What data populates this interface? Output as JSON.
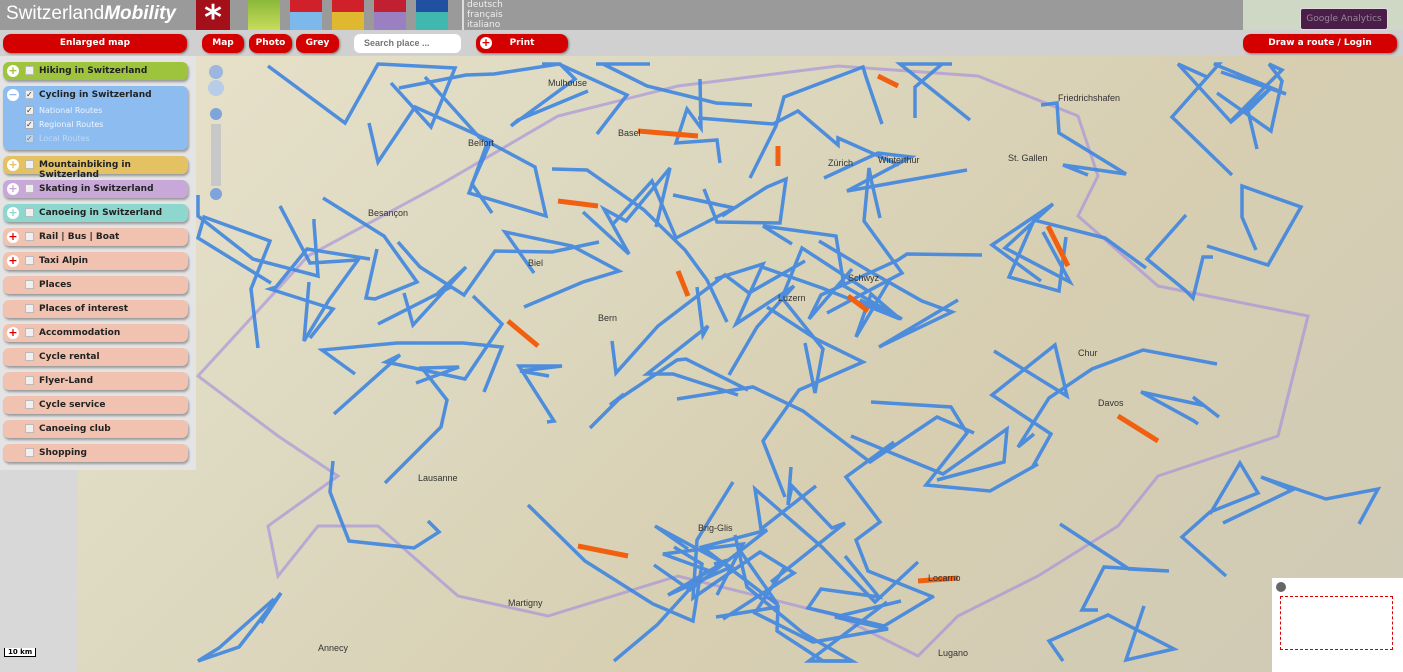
{
  "header": {
    "logo_regular": "Switzerland",
    "logo_bold": "Mobility",
    "languages": [
      "deutsch",
      "français",
      "italiano"
    ],
    "analytics_label": "Google Analytics"
  },
  "toolbar": {
    "enlarged_map": "Enlarged map",
    "map": "Map",
    "photo": "Photo",
    "grey": "Grey",
    "search_placeholder": "Search place ...",
    "print": "Print",
    "draw_route": "Draw a route / Login"
  },
  "sidebar": {
    "items": [
      {
        "label": "Hiking in Switzerland",
        "color": "#9dc43c",
        "toggle": "+",
        "checked": false
      },
      {
        "label": "Cycling in Switzerland",
        "color": "#8dbdf0",
        "toggle": "−",
        "checked": true
      },
      {
        "label": "Mountainbiking in Switzerland",
        "color": "#e4c163",
        "toggle": "+",
        "checked": false
      },
      {
        "label": "Skating in Switzerland",
        "color": "#c8a8d8",
        "toggle": "+",
        "checked": false
      },
      {
        "label": "Canoeing in Switzerland",
        "color": "#8ed7cf",
        "toggle": "+",
        "checked": false
      },
      {
        "label": "Rail | Bus | Boat",
        "color": "#f1c2b0",
        "toggle": "+",
        "checked": false
      },
      {
        "label": "Taxi Alpin",
        "color": "#f1c2b0",
        "toggle": "+",
        "checked": false
      },
      {
        "label": "Places",
        "color": "#f1c2b0",
        "toggle": "",
        "checked": false
      },
      {
        "label": "Places of interest",
        "color": "#f1c2b0",
        "toggle": "",
        "checked": false
      },
      {
        "label": "Accommodation",
        "color": "#f1c2b0",
        "toggle": "+",
        "checked": false
      },
      {
        "label": "Cycle rental",
        "color": "#f1c2b0",
        "toggle": "",
        "checked": false
      },
      {
        "label": "Flyer-Land",
        "color": "#f1c2b0",
        "toggle": "",
        "checked": false
      },
      {
        "label": "Cycle service",
        "color": "#f1c2b0",
        "toggle": "",
        "checked": false
      },
      {
        "label": "Canoeing club",
        "color": "#f1c2b0",
        "toggle": "",
        "checked": false
      },
      {
        "label": "Shopping",
        "color": "#f1c2b0",
        "toggle": "",
        "checked": false
      }
    ],
    "cycling_subitems": [
      "National Routes",
      "Regional Routes",
      "Local Routes"
    ]
  },
  "map": {
    "scale": "10 km",
    "labels": [
      "Mulhouse",
      "Basel",
      "Belfort",
      "Zürich",
      "Besançon",
      "Bern",
      "Luzern",
      "Lausanne",
      "Chur",
      "Davos",
      "Lugano",
      "Annecy",
      "Friedrichshafen",
      "St. Gallen",
      "Winterthur",
      "Biel",
      "Schwyz",
      "Locarno",
      "Martigny",
      "Brig-Glis"
    ],
    "route_color": "#3f86e0",
    "highlight_color": "#f06010"
  }
}
